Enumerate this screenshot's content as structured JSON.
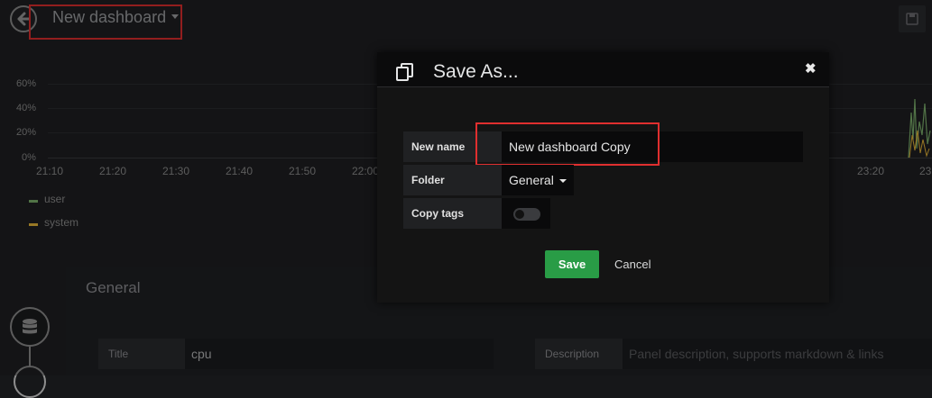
{
  "header": {
    "dashboard_title": "New dashboard"
  },
  "graph": {
    "y_ticks": [
      "60%",
      "40%",
      "20%",
      "0%"
    ],
    "x_ticks": [
      "21:10",
      "21:20",
      "21:30",
      "21:40",
      "21:50",
      "22:00",
      "23:20",
      "23"
    ],
    "legend": [
      {
        "label": "user",
        "color": "#7eb26d"
      },
      {
        "label": "system",
        "color": "#eab839"
      }
    ]
  },
  "editor": {
    "section_title": "General",
    "title_label": "Title",
    "title_value": "cpu",
    "description_label": "Description",
    "description_placeholder": "Panel description, supports markdown & links"
  },
  "modal": {
    "title": "Save As...",
    "close_glyph": "✖",
    "new_name_label": "New name",
    "new_name_value": "New dashboard Copy",
    "folder_label": "Folder",
    "folder_value": "General",
    "copy_tags_label": "Copy tags",
    "copy_tags_on": false,
    "save_label": "Save",
    "cancel_label": "Cancel"
  },
  "colors": {
    "highlight": "#e02f2f",
    "save_button": "#299c46"
  }
}
